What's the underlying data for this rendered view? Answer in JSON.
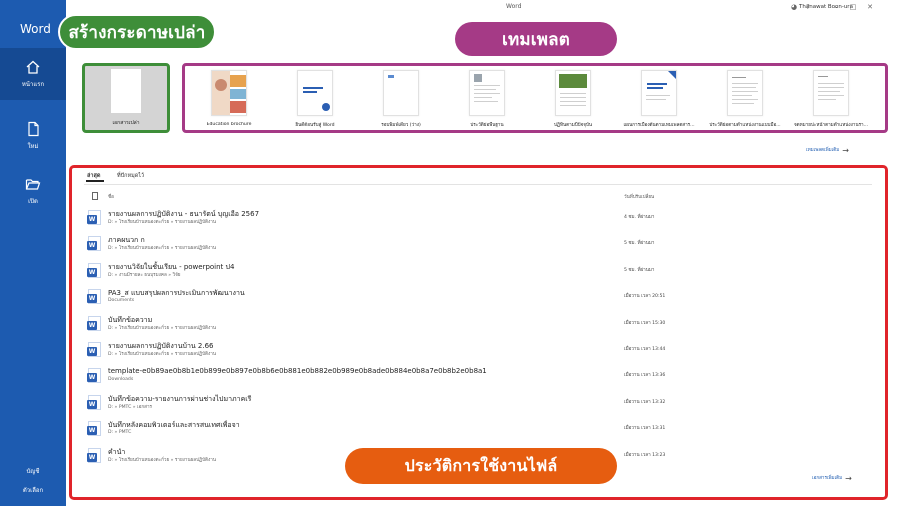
{
  "app": {
    "name": "Word",
    "window_title": "Word",
    "user": "Thanawat Boon-ura"
  },
  "nav": {
    "items": [
      {
        "label": "หน้าแรก",
        "icon": "home-icon"
      },
      {
        "label": "ใหม่",
        "icon": "new-document-icon"
      },
      {
        "label": "เปิด",
        "icon": "open-folder-icon"
      }
    ],
    "account": "บัญชี",
    "options": "ตัวเลือก"
  },
  "callouts": {
    "blank": "สร้างกระดาษเปล่า",
    "templates": "เทมเพลต",
    "history": "ประวัติการใช้งานไฟล์"
  },
  "blank_doc": {
    "label": "เอกสารเปล่า"
  },
  "templates": [
    {
      "label": "Education brochure",
      "style": "photo"
    },
    {
      "label": "ยินดีต้อนรับสู่ Word",
      "style": "tour"
    },
    {
      "label": "รอบพิมพ์เดียว (ว่าง)",
      "style": "plain"
    },
    {
      "label": "ประวัติย่อพื้นฐาน",
      "style": "resume"
    },
    {
      "label": "ปฏิทินตามปีปัจจุบัน",
      "style": "calendar"
    },
    {
      "label": "แผนการเบื้องต้นตามเทมเพลตสาร...",
      "style": "blue"
    },
    {
      "label": "ประวัติย่อตามตำแหน่งงานแบบมือ...",
      "style": "lines"
    },
    {
      "label": "จดหมายปะหน้าตามตำแหน่งงานรา...",
      "style": "letter"
    }
  ],
  "more_templates": "เทมเพลตเพิ่มเติม",
  "recent": {
    "tabs": [
      "ล่าสุด",
      "ที่ปักหมุดไว้"
    ],
    "col_name": "ชื่อ",
    "col_modified": "วันที่ปรับเปลี่ยน",
    "files": [
      {
        "name": "รายงานผลการปฏิบัติงาน - ธนารัตน์ บุญเอือ 2567",
        "path": "D: » โรงเรียนบ้านหนองตะกั่วย » รายงานผลปฏิบัติงาน",
        "date": "4 ชม. ที่ผ่านมา"
      },
      {
        "name": "ภาคผนวก ก",
        "path": "D: » โรงเรียนบ้านหนองตะกั่วย » รายงานผลปฏิบัติงาน",
        "date": "5 ชม. ที่ผ่านมา"
      },
      {
        "name": "รายงานวิจัยในชั้นเรียน - powerpoint ป4",
        "path": "D: » งานมีรายละ ธนบุรมงคล » วิจัย",
        "date": "5 ชม. ที่ผ่านมา"
      },
      {
        "name": "PA3_ส แบบสรุปผลการประเมินการพัฒนางาน",
        "path": "Documents",
        "date": "เมื่อวาน เวลา 20:51"
      },
      {
        "name": "บันทึกข้อความ",
        "path": "D: » โรงเรียนบ้านหนองตะกั่วย » รายงานผลปฏิบัติงาน",
        "date": "เมื่อวาน เวลา 15:30"
      },
      {
        "name": "รายงานผลการปฏิบัติงานบ้าน 2.66",
        "path": "D: » โรงเรียนบ้านหนองตะกั่วย » รายงานผลปฏิบัติงาน",
        "date": "เมื่อวาน เวลา 13:44"
      },
      {
        "name": "template-e0b89ae0b8b1e0b899e0b897e0b8b6e0b881e0b882e0b989e0b8ade0b884e0b8a7e0b8b2e0b8a1",
        "path": "Downloads",
        "date": "เมื่อวาน เวลา 13:36"
      },
      {
        "name": "บันทึกข้อความ-รายงานการผ่านช่างไปมาภาคเรี",
        "path": "D: » PMTC » เอกสาร",
        "date": "เมื่อวาน เวลา 13:32"
      },
      {
        "name": "บันทึกหลังคอมพิวเตอร์และสารสนเทศเพื่อจา",
        "path": "D: » PMTC",
        "date": "เมื่อวาน เวลา 13:31"
      },
      {
        "name": "คำนำ",
        "path": "D: » โรงเรียนบ้านหนองตะกั่วย » รายงานผลปฏิบัติงาน",
        "date": "เมื่อวาน เวลา 13:23"
      }
    ],
    "more_files": "เอกสารเพิ่มเติม"
  },
  "colors": {
    "nav": "#1d5bb0",
    "green": "#3e8e39",
    "purple": "#a53a86",
    "orange": "#e65d10",
    "red": "#e0242a"
  }
}
